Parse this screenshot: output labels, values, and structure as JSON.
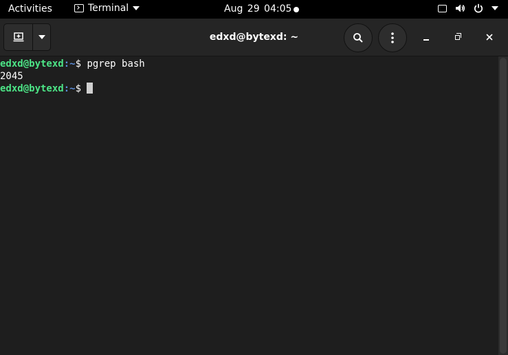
{
  "topbar": {
    "activities": "Activities",
    "app_name": "Terminal",
    "clock": "Aug 29  04:05",
    "tray_icons": [
      "screen-icon",
      "volume-icon",
      "power-icon",
      "chevron-down-icon"
    ]
  },
  "window": {
    "title": "edxd@bytexd: ~"
  },
  "terminal": {
    "lines": [
      {
        "user": "edxd@bytexd",
        "path": ":~",
        "symbol": "$ ",
        "command": "pgrep bash"
      },
      {
        "output": "2045"
      },
      {
        "user": "edxd@bytexd",
        "path": ":~",
        "symbol": "$ ",
        "command": ""
      }
    ]
  },
  "colors": {
    "prompt_user": "#4ce486",
    "prompt_path": "#5b8dd9",
    "background": "#1e1e1e"
  }
}
